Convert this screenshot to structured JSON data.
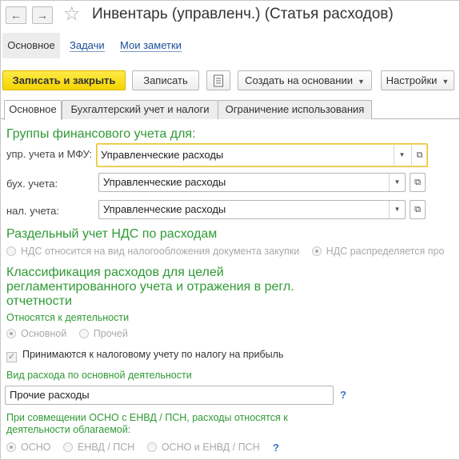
{
  "window": {
    "back_icon": "arrow-left-icon",
    "forward_icon": "arrow-right-icon",
    "favorite_icon": "star-icon",
    "title": "Инвентарь (управленч.) (Статья расходов)"
  },
  "sections": {
    "main": "Основное",
    "tasks": "Задачи",
    "notes": "Мои заметки"
  },
  "toolbar": {
    "save_close": "Записать и закрыть",
    "save": "Записать",
    "report_icon": "document-icon",
    "create_based": "Создать на основании",
    "settings": "Настройки"
  },
  "tabs": [
    {
      "label": "Основное",
      "active": true
    },
    {
      "label": "Бухгалтерский учет и налоги",
      "active": false
    },
    {
      "label": "Ограничение использования",
      "active": false
    }
  ],
  "fin_groups": {
    "title": "Группы финансового учета для:",
    "rows": [
      {
        "label": "упр. учета и МФУ:",
        "value": "Управленческие расходы"
      },
      {
        "label": "бух. учета:",
        "value": "Управленческие расходы"
      },
      {
        "label": "нал. учета:",
        "value": "Управленческие расходы"
      }
    ]
  },
  "vat": {
    "title": "Раздельный учет НДС по расходам",
    "option1": "НДС относится на вид налогообложения документа закупки",
    "option2": "НДС распределяется про"
  },
  "classification": {
    "title": "Классификация расходов для целей регламентированного учета и отражения в регл. отчетности",
    "activity_label": "Относятся к деятельности",
    "activity_main": "Основной",
    "activity_other": "Прочей",
    "profit_tax_checkbox": "Принимаются к налоговому учету по налогу на прибыль",
    "expense_type_label": "Вид расхода по основной деятельности",
    "expense_type_value": "Прочие расходы",
    "help_mark": "?",
    "combined_label": "При совмещении ОСНО с ЕНВД / ПСН, расходы относятся к деятельности облагаемой:",
    "combined_options": [
      "ОСНО",
      "ЕНВД / ПСН",
      "ОСНО и ЕНВД / ПСН"
    ]
  },
  "colors": {
    "accent_green": "#2f9a35",
    "primary_button": "#f5d400",
    "link_blue": "#1a4e99",
    "focus_border": "#e8c53a"
  }
}
